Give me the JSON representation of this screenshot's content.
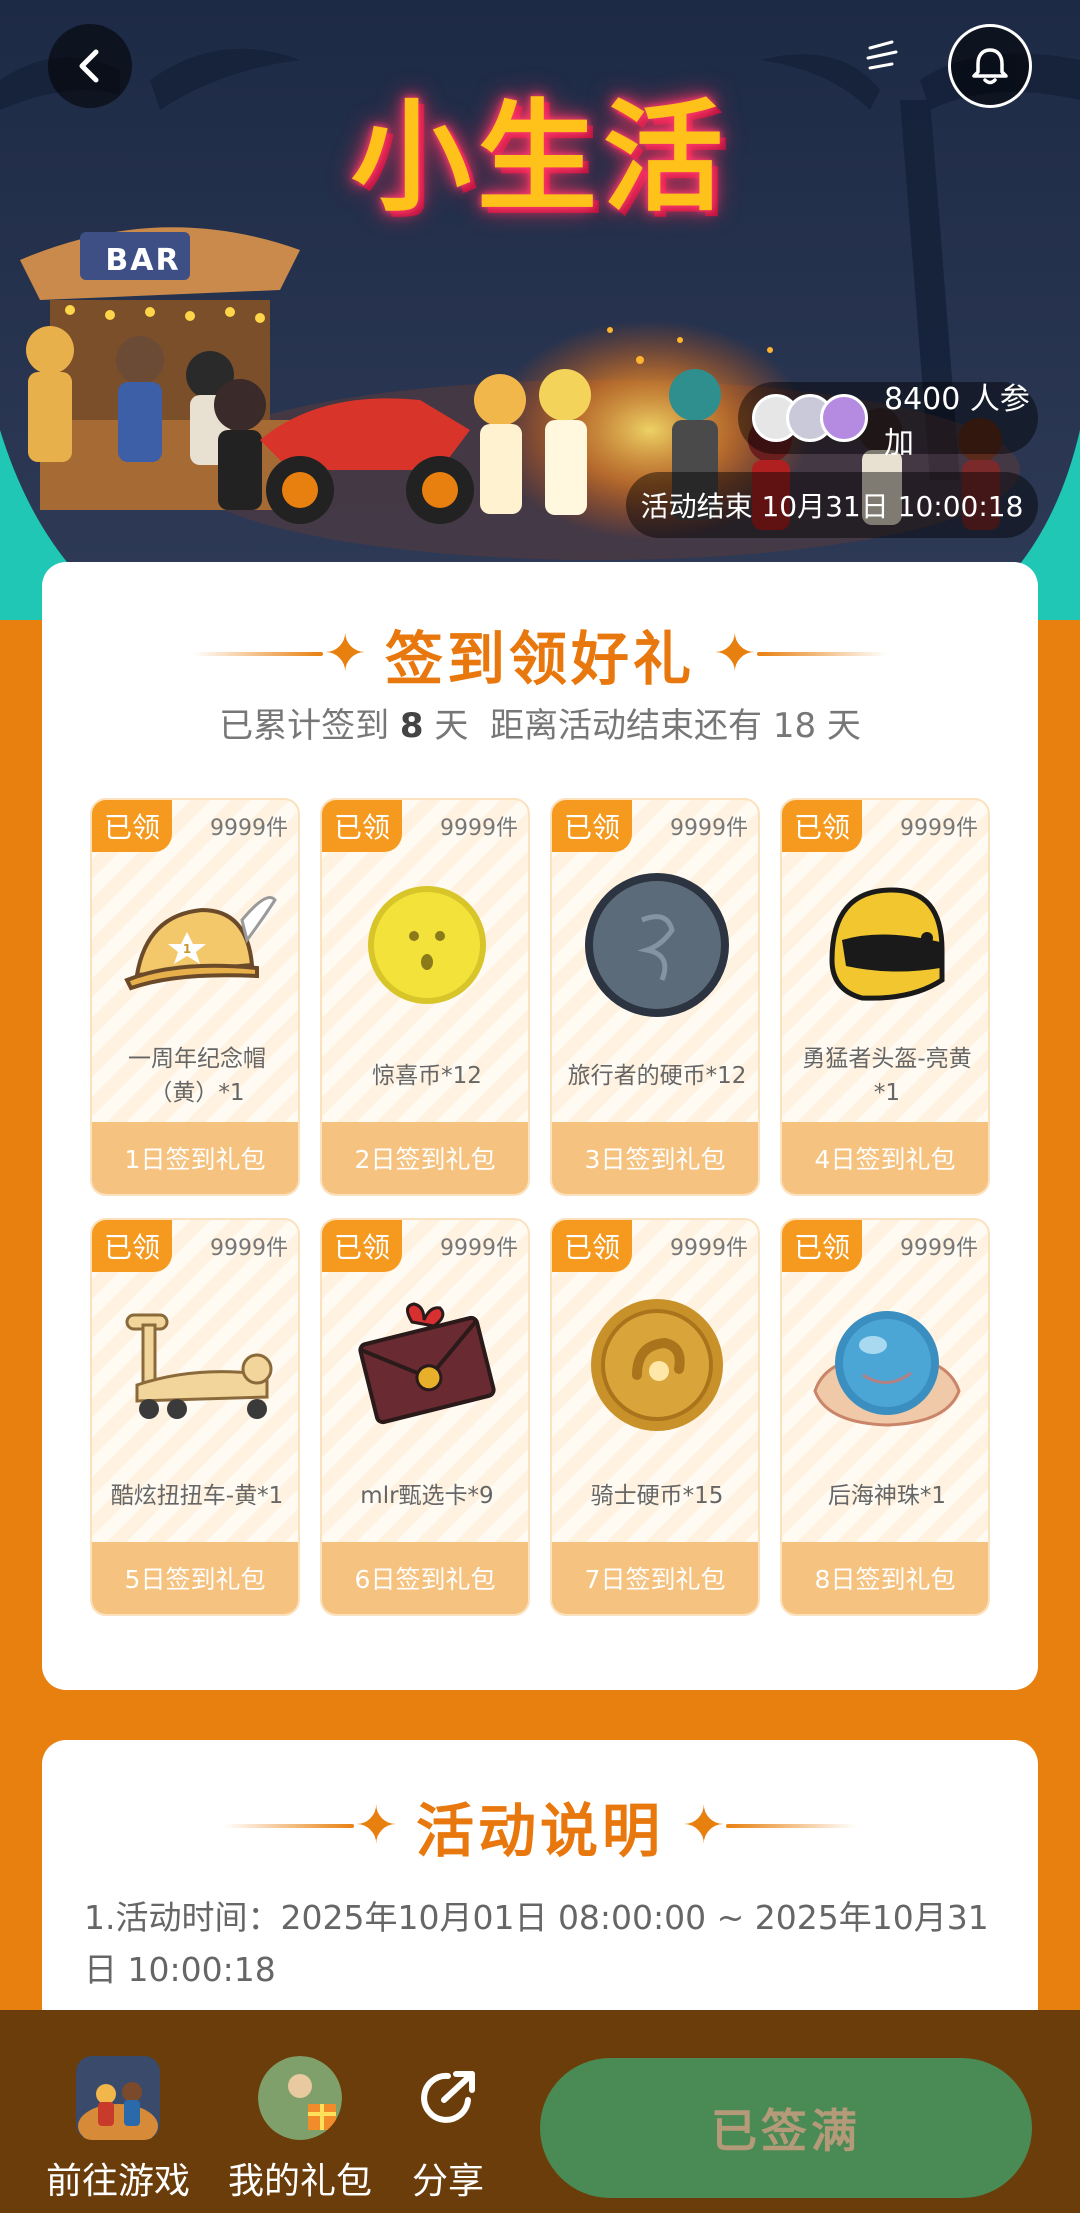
{
  "hero": {
    "title": "小生活",
    "bar_sign": "BAR",
    "participants": "8400 人参加",
    "end_time": "活动结束 10月31日 10:00:18"
  },
  "checkin": {
    "title": "签到领好礼",
    "summary_prefix": "已累计签到",
    "days_checked": "8",
    "summary_mid": "天  距离活动结束还有",
    "days_left": "18",
    "summary_suffix": "天",
    "rewards": [
      {
        "tag": "已领",
        "stock": "9999件",
        "name": "一周年纪念帽（黄）*1",
        "day": "1日签到礼包",
        "icon": "cap-icon"
      },
      {
        "tag": "已领",
        "stock": "9999件",
        "name": "惊喜币*12",
        "day": "2日签到礼包",
        "icon": "surprise-coin-icon"
      },
      {
        "tag": "已领",
        "stock": "9999件",
        "name": "旅行者的硬币*12",
        "day": "3日签到礼包",
        "icon": "traveler-coin-icon"
      },
      {
        "tag": "已领",
        "stock": "9999件",
        "name": "勇猛者头盔-亮黄*1",
        "day": "4日签到礼包",
        "icon": "helmet-icon"
      },
      {
        "tag": "已领",
        "stock": "9999件",
        "name": "酷炫扭扭车-黄*1",
        "day": "5日签到礼包",
        "icon": "scooter-icon"
      },
      {
        "tag": "已领",
        "stock": "9999件",
        "name": "mlr甄选卡*9",
        "day": "6日签到礼包",
        "icon": "envelope-card-icon"
      },
      {
        "tag": "已领",
        "stock": "9999件",
        "name": "骑士硬币*15",
        "day": "7日签到礼包",
        "icon": "knight-coin-icon"
      },
      {
        "tag": "已领",
        "stock": "9999件",
        "name": "后海神珠*1",
        "day": "8日签到礼包",
        "icon": "pearl-icon"
      }
    ]
  },
  "rules": {
    "title": "活动说明",
    "line1": "1.活动时间：2025年10月01日 08:00:00 ~ 2025年10月31日 10:00:18"
  },
  "bottom_bar": {
    "go_game": "前往游戏",
    "my_gifts": "我的礼包",
    "share": "分享",
    "signed_full": "已签满"
  },
  "colors": {
    "page_bg": "#E8800F",
    "accent": "#E8780E",
    "tag_bg": "#F59A1E",
    "day_bar": "#F6C27F",
    "bottom_bar": "#6B3D0A",
    "signed_button": "#4A8B55"
  }
}
